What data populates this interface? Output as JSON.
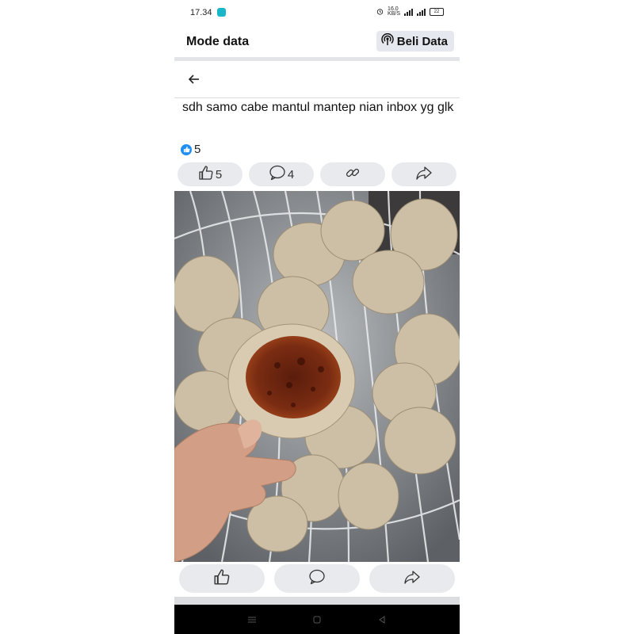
{
  "status_bar": {
    "time": "17.34",
    "data_speed": "16.0\nKB/S",
    "battery_level": "22"
  },
  "appbar": {
    "title": "Mode data",
    "buy_data_label": "Beli Data"
  },
  "post": {
    "text": "sdh samo cabe mantul mantep nian inbox yg glk",
    "reaction_count": "5"
  },
  "actions": {
    "like_count": "5",
    "comment_count": "4"
  },
  "photo": {
    "subject": "hand holding a cracker with chili sauce above a tray of crackers"
  },
  "colors": {
    "like_blue": "#1f8ff3",
    "pill_bg": "#e8eaee",
    "divider": "#e4e5e9"
  },
  "icons": [
    "back-arrow-icon",
    "thumbs-up-icon",
    "comment-icon",
    "link-icon",
    "share-icon",
    "broadcast-icon"
  ]
}
